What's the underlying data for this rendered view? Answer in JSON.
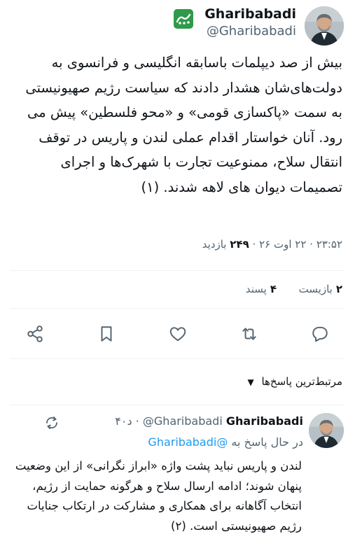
{
  "tweet": {
    "display_name": "Gharibabadi",
    "handle": "@Gharibabadi",
    "text": "بیش از صد دیپلمات باسابقه انگلیسی و فرانسوی به دولت‌های‌شان هشدار دادند که سیاست رژیم صهیونیستی به سمت «پاکسازی قومی» و «محو فلسطین» پیش می رود. آنان خواستار اقدام عملی لندن و پاریس در توقف انتقال سلاح، ممنوعیت تجارت با شهرک‌ها و اجرای تصمیمات دیوان های لاهه شدند. (۱)",
    "time": "۲۳:۵۲",
    "date": "۲۲ اوت ۲۶",
    "views_count": "۲۴۹",
    "views_label": "بازدید",
    "retweets_count": "۲",
    "retweets_label": "بازیست",
    "likes_count": "۴",
    "likes_label": "پسند"
  },
  "actions": {
    "share_icon": "share-icon",
    "bookmark_icon": "bookmark-icon",
    "like_icon": "heart-icon",
    "retweet_icon": "retweet-icon",
    "reply_icon": "comment-icon"
  },
  "replies_sort": {
    "label": "مرتبط‌ترین پاسخ‌ها"
  },
  "reply": {
    "display_name": "Gharibabadi",
    "handle": "@Gharibabadi",
    "time": "۴۰د",
    "replying_to_label": "در حال پاسخ به",
    "replying_to_handle": "@Gharibabadi",
    "text": "لندن و پاریس نباید پشت واژه «ابراز نگرانی» از این وضعیت پنهان شوند؛ ادامه ارسال سلاح و هرگونه حمایت از رژیم، انتخاب آگاهانه برای همکاری و مشارکت در ارتکاب جنایات رژیم صهیونیستی است. (۲)"
  },
  "colors": {
    "text": "#0f1419",
    "secondary": "#536471",
    "link": "#1d9bf0",
    "badge": "#2f9a4a"
  }
}
